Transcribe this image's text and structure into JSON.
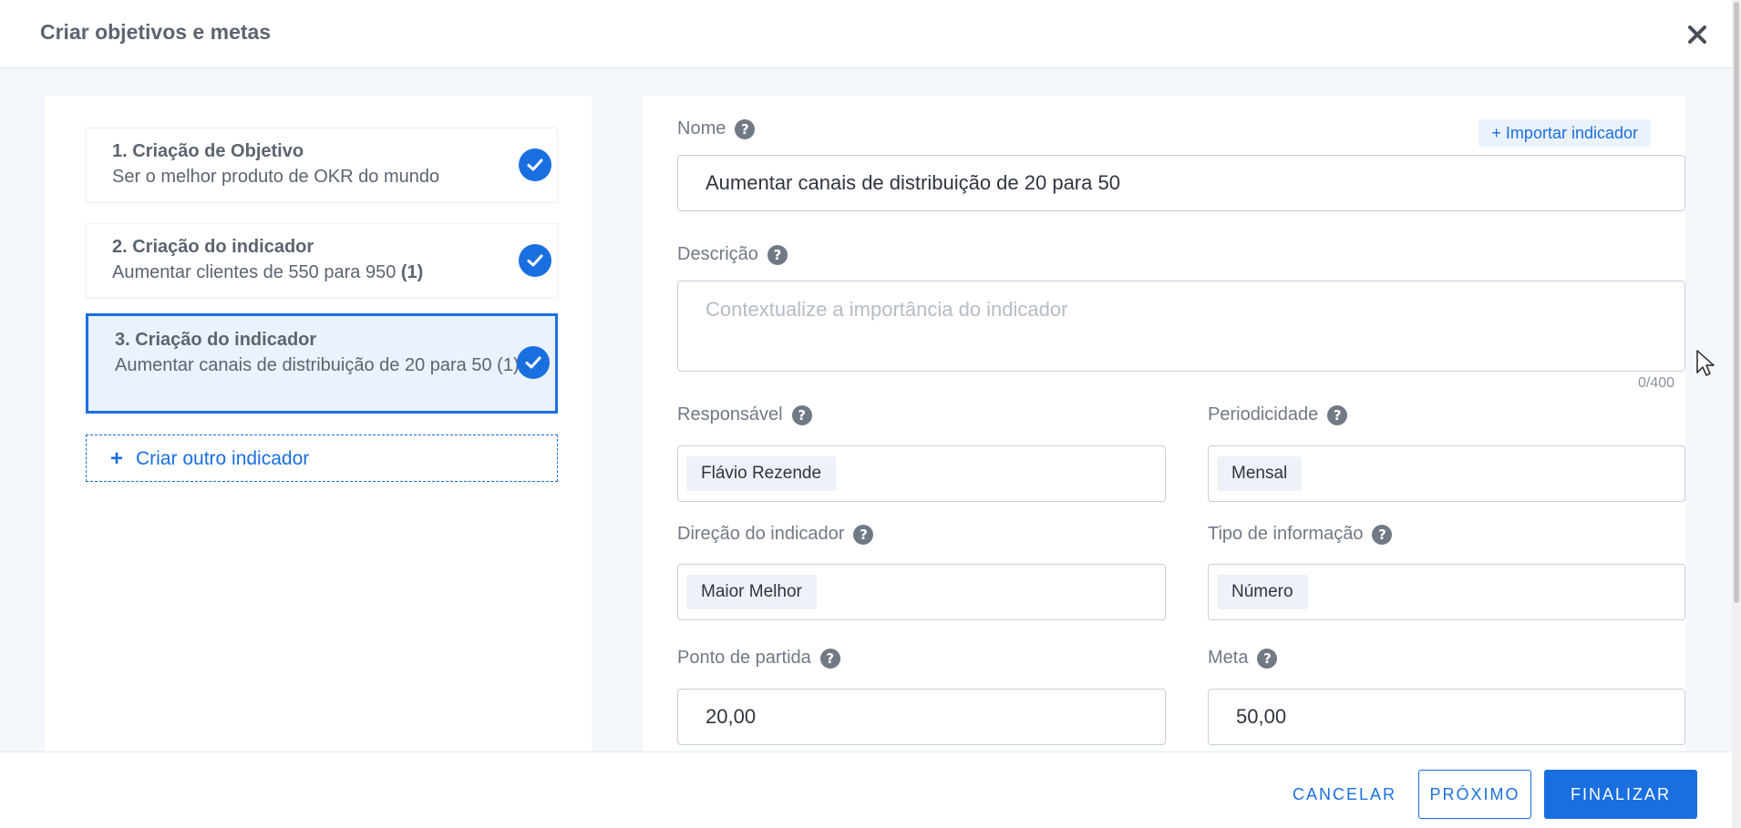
{
  "header": {
    "title": "Criar objetivos e metas"
  },
  "steps": [
    {
      "title": "1. Criação de Objetivo",
      "subtitle": "Ser o melhor produto de OKR do mundo",
      "count": ""
    },
    {
      "title": "2. Criação do indicador",
      "subtitle": "Aumentar clientes de 550 para 950",
      "count": "(1)"
    },
    {
      "title": "3. Criação do indicador",
      "subtitle": "Aumentar canais de distribuição de 20 para 50",
      "count": "(1)"
    }
  ],
  "add_indicator": {
    "plus": "+",
    "label": "Criar outro indicador"
  },
  "form": {
    "name_label": "Nome",
    "import_label": "+ Importar indicador",
    "name_value": "Aumentar canais de distribuição de 20 para 50",
    "description_label": "Descrição",
    "description_placeholder": "Contextualize a importância do indicador",
    "description_counter": "0/400",
    "owner_label": "Responsável",
    "owner_value": "Flávio Rezende",
    "period_label": "Periodicidade",
    "period_value": "Mensal",
    "direction_label": "Direção do indicador",
    "direction_value": "Maior Melhor",
    "info_type_label": "Tipo de informação",
    "info_type_value": "Número",
    "start_label": "Ponto de partida",
    "start_value": "20,00",
    "goal_label": "Meta",
    "goal_value": "50,00",
    "help_glyph": "?"
  },
  "footer": {
    "cancel": "CANCELAR",
    "next": "PRÓXIMO",
    "finish": "FINALIZAR"
  },
  "icons": {
    "close": "close-icon",
    "check": "check-circle-icon",
    "help": "question-circle-icon",
    "cursor": "mouse-pointer-icon"
  },
  "colors": {
    "primary": "#1a6fe0",
    "active_bg": "#eaf2fd",
    "text": "#3d4451",
    "muted": "#717985"
  }
}
